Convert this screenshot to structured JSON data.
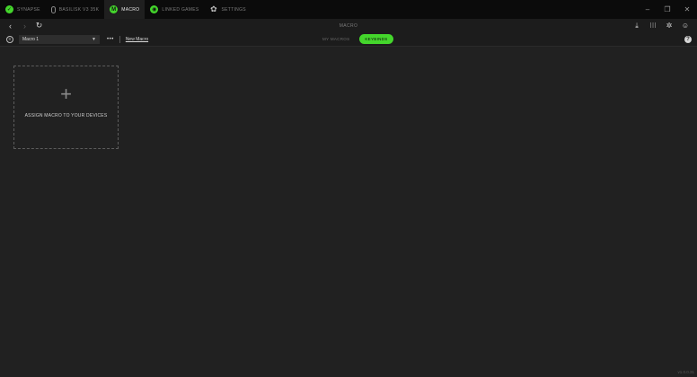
{
  "tabs": [
    {
      "label": "SYNAPSE",
      "icon": "synapse-icon",
      "active": false
    },
    {
      "label": "BASILISK V3 35K",
      "icon": "mouse-icon",
      "active": false
    },
    {
      "label": "MACRO",
      "icon": "macro-icon",
      "active": true
    },
    {
      "label": "LINKED GAMES",
      "icon": "linked-games-icon",
      "active": false
    },
    {
      "label": "SETTINGS",
      "icon": "gear-icon",
      "active": false
    }
  ],
  "nav": {
    "title": "MACRO"
  },
  "toolbar": {
    "selected_macro": "Macro 1",
    "more_label": "•••",
    "new_macro_label": "New Macro",
    "tab_my_macros": "MY MACROS",
    "tab_keybinds": "KEYBINDS"
  },
  "card": {
    "plus": "+",
    "label": "ASSIGN MACRO TO YOUR DEVICES"
  },
  "version": "v1.0.0.31",
  "colors": {
    "accent": "#44d62c",
    "background": "#212121",
    "titlebar": "#0b0b0b"
  }
}
